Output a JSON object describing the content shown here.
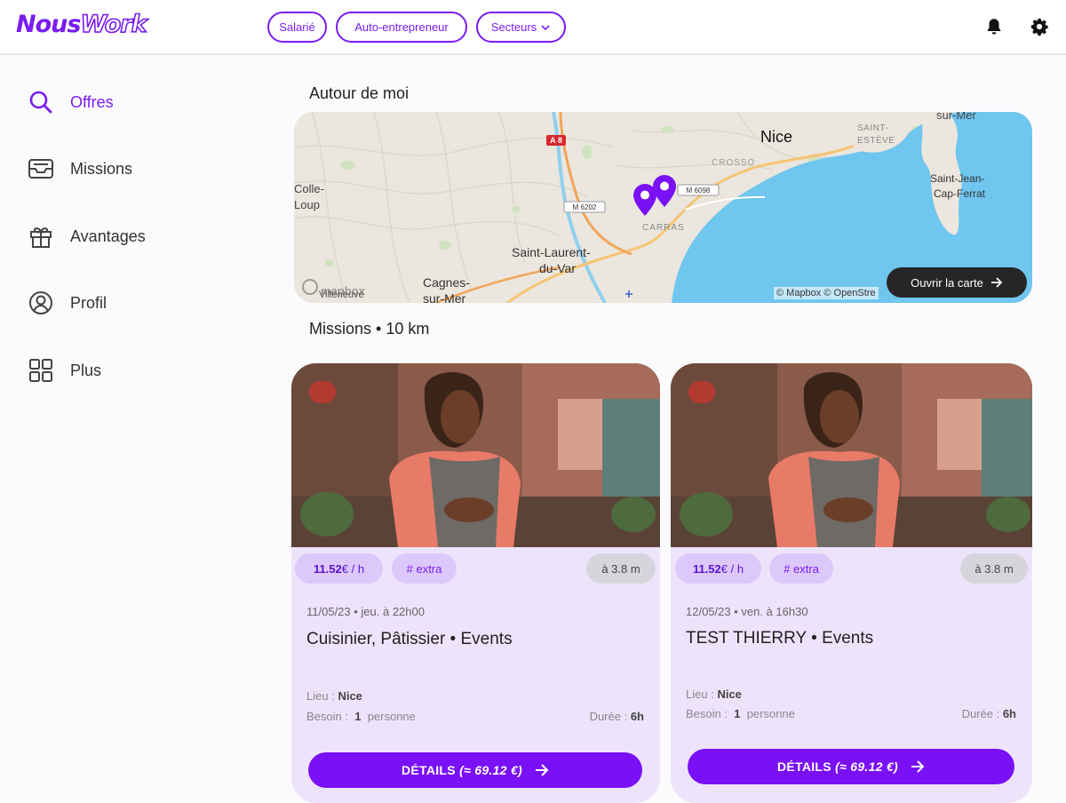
{
  "header": {
    "logo_part1": "Nous",
    "logo_part2": "Work",
    "pills": [
      {
        "label": "Salarié"
      },
      {
        "label": "Auto-entrepreneur"
      },
      {
        "label": "Secteurs"
      }
    ],
    "icons": [
      "bell-icon",
      "gear-icon"
    ]
  },
  "sidebar": {
    "items": [
      {
        "label": "Offres",
        "icon": "search-icon",
        "active": true
      },
      {
        "label": "Missions",
        "icon": "inbox-icon",
        "active": false
      },
      {
        "label": "Avantages",
        "icon": "gift-icon",
        "active": false
      },
      {
        "label": "Profil",
        "icon": "user-circle-icon",
        "active": false
      },
      {
        "label": "Plus",
        "icon": "grid-icon",
        "active": false
      }
    ]
  },
  "main": {
    "around_title": "Autour de moi",
    "missions_title": "Missions • 10 km",
    "map": {
      "labels": {
        "nice": "Nice",
        "sur_mer": "sur-Mer",
        "saint_esteve": "SAINT-ESTÈVE",
        "saint_jean_1": "Saint-Jean-",
        "saint_jean_2": "Cap-Ferrat",
        "colle_1": "Colle-",
        "colle_2": "Loup",
        "saint_laurent_1": "Saint-Laurent-",
        "saint_laurent_2": "du-Var",
        "cagnes_1": "Cagnes-",
        "cagnes_2": "sur-Mer",
        "villeneuve": "Villeneuve",
        "carras": "CARRAS",
        "crosso": "CROSSO",
        "a8": "A 8",
        "m6202": "M 6202",
        "m6098": "M 6098"
      },
      "mapbox_logo": "mapbox",
      "attribution": "© Mapbox © OpenStre",
      "open_button": "Ouvrir la carte"
    },
    "cards": [
      {
        "rate_value": "11.52",
        "rate_unit": " € / h",
        "tag": "# extra",
        "distance": "à 3.8 m",
        "date": "11/05/23 • jeu. à 22h00",
        "title": "Cuisinier, Pâtissier • Events",
        "lieu_label": "Lieu :",
        "lieu_value": "Nice",
        "besoin_label": "Besoin :",
        "besoin_count": "1",
        "besoin_unit": "personne",
        "duree_label": "Durée :",
        "duree_value": "6h",
        "button_label": "DÉTAILS",
        "button_amount": "(≈ 69.12 €)"
      },
      {
        "rate_value": "11.52",
        "rate_unit": " € / h",
        "tag": "# extra",
        "distance": "à 3.8 m",
        "date": "12/05/23 • ven. à 16h30",
        "title": "TEST THIERRY • Events",
        "lieu_label": "Lieu :",
        "lieu_value": "Nice",
        "besoin_label": "Besoin :",
        "besoin_count": "1",
        "besoin_unit": "personne",
        "duree_label": "Durée :",
        "duree_value": "6h",
        "button_label": "DÉTAILS",
        "button_amount": "(≈ 69.12 €)"
      }
    ]
  },
  "colors": {
    "accent": "#7a1cf0",
    "card_bg": "#ede4fc",
    "chip_bg": "#dcc8fb",
    "sea": "#6fc6ee"
  }
}
